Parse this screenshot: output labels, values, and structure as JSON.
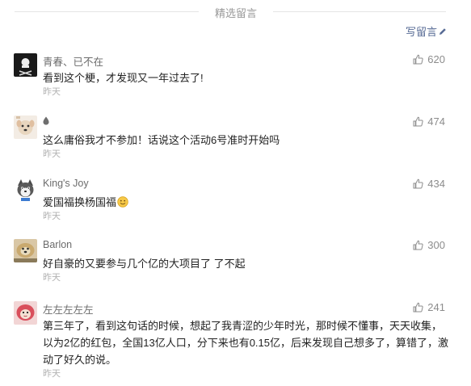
{
  "header": {
    "title": "精选留言",
    "write_label": "写留言"
  },
  "comments": [
    {
      "nickname": "青春、已不在",
      "text": "看到这个梗，才发现又一年过去了!",
      "time": "昨天",
      "likes": "620"
    },
    {
      "nickname": "",
      "text": "这么庸俗我才不参加！话说这个活动6号准时开始吗",
      "time": "昨天",
      "likes": "474"
    },
    {
      "nickname": "King's Joy",
      "text": "爱国福换杨国福",
      "time": "昨天",
      "likes": "434"
    },
    {
      "nickname": "Barlon",
      "text": "好自豪的又要参与几个亿的大项目了 了不起",
      "time": "昨天",
      "likes": "300"
    },
    {
      "nickname": "左左左左左",
      "text_lines": [
        "第三年了，看到这句话的时候，想起了我青涩的少年时光，那时候不懂事，天天收集，",
        "以为2亿的红包，全国13亿人口，分下来也有0.15亿，后来发现自己想多了，算错了，激",
        "动了好久的说。"
      ],
      "time": "昨天",
      "likes": "241"
    }
  ],
  "colors": {
    "link": "#576b95",
    "meta": "#b2b2b2",
    "text": "#222222"
  },
  "icons": {
    "like": "thumbs-up-icon",
    "write": "pencil-icon",
    "nickname_2": "droplet-icon",
    "emoji": "smile-emoji-icon"
  }
}
